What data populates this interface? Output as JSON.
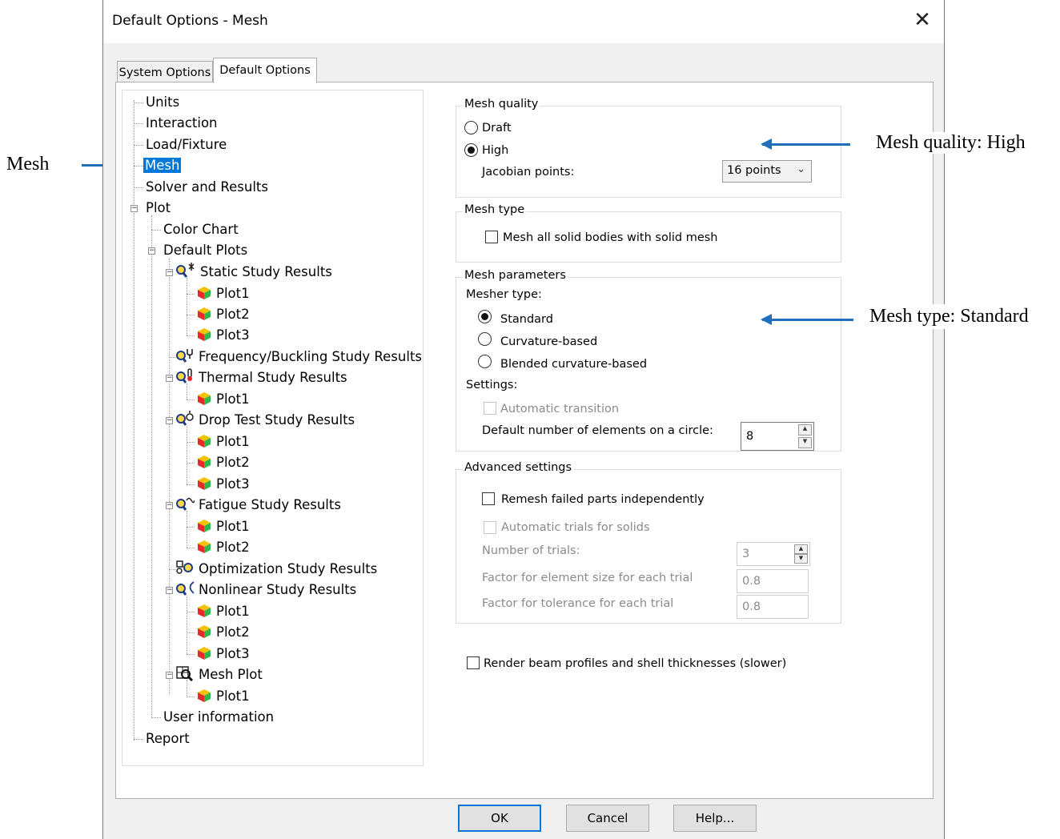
{
  "annotations": {
    "left_label": "Mesh",
    "right_label_1": "Mesh quality: High",
    "right_label_2": "Mesh type: Standard"
  },
  "window": {
    "title": "Default Options - Mesh",
    "close_glyph": "✕"
  },
  "tabs": [
    {
      "label": "System Options",
      "active": false
    },
    {
      "label": "Default Options",
      "active": true
    }
  ],
  "tree": {
    "selected": "Mesh",
    "items": [
      "Units",
      "Interaction",
      "Load/Fixture",
      "Mesh",
      "Solver and Results",
      "Plot",
      "Color Chart",
      "Default Plots",
      "Static Study Results",
      "Plot1",
      "Plot2",
      "Plot3",
      "Frequency/Buckling Study Results",
      "Thermal Study Results",
      "Plot1",
      "Drop Test Study Results",
      "Plot1",
      "Plot2",
      "Plot3",
      "Fatigue Study Results",
      "Plot1",
      "Plot2",
      "Optimization Study Results",
      "Nonlinear Study Results",
      "Plot1",
      "Plot2",
      "Plot3",
      "Mesh Plot",
      "Plot1",
      "User information",
      "Report"
    ]
  },
  "mesh_quality": {
    "title": "Mesh quality",
    "draft_label": "Draft",
    "high_label": "High",
    "selected": "High",
    "jacobian_label": "Jacobian points:",
    "jacobian_value": "16 points"
  },
  "mesh_type": {
    "title": "Mesh type",
    "solid_checkbox_label": "Mesh all solid bodies with solid mesh",
    "solid_checked": false
  },
  "mesh_parameters": {
    "title": "Mesh parameters",
    "mesher_type_label": "Mesher type:",
    "options": [
      "Standard",
      "Curvature-based",
      "Blended curvature-based"
    ],
    "selected": "Standard",
    "settings_label": "Settings:",
    "auto_transition_label": "Automatic transition",
    "elements_on_circle_label": "Default number of elements on a circle:",
    "elements_on_circle_value": "8"
  },
  "advanced": {
    "title": "Advanced settings",
    "remesh_label": "Remesh failed parts independently",
    "auto_trials_label": "Automatic trials for solids",
    "num_trials_label": "Number of trials:",
    "num_trials_value": "3",
    "factor_size_label": "Factor for element size for each trial",
    "factor_size_value": "0.8",
    "factor_tol_label": "Factor for tolerance for each trial",
    "factor_tol_value": "0.8"
  },
  "render_beam_label": "Render beam profiles and shell thicknesses (slower)",
  "buttons": {
    "ok": "OK",
    "cancel": "Cancel",
    "help": "Help..."
  },
  "colors": {
    "accent": "#0078d7",
    "annotation_arrow": "#1f6fba"
  }
}
